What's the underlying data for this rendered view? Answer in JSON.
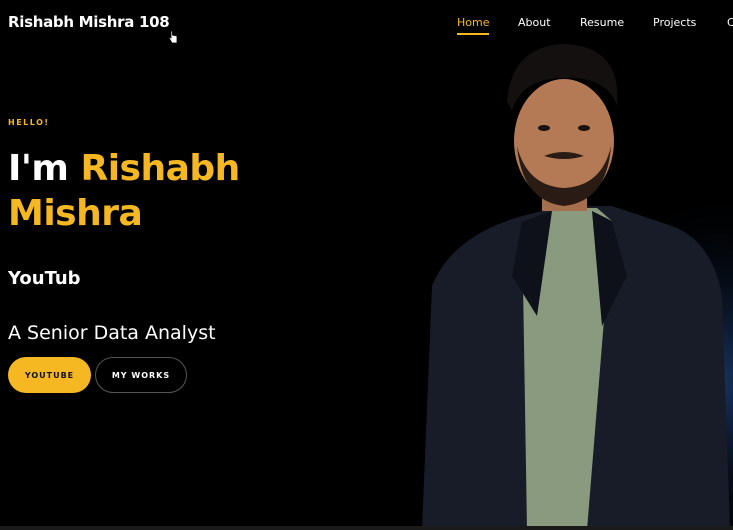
{
  "header": {
    "brand": "Rishabh Mishra 108",
    "nav": [
      "Home",
      "About",
      "Resume",
      "Projects",
      "C"
    ],
    "active": "Home"
  },
  "hero": {
    "greeting": "HELLO!",
    "intro": "I'm",
    "first_name": "Rishabh",
    "last_name": "Mishra",
    "subtitle": "YouTub",
    "role": "A Senior Data Analyst",
    "buttons": {
      "primary": "YOUTUBE",
      "secondary": "MY WORKS"
    }
  },
  "colors": {
    "accent": "#f5b823",
    "background": "#000000",
    "text": "#ffffff"
  },
  "icons": {
    "cursor": "hand-pointer-icon"
  }
}
